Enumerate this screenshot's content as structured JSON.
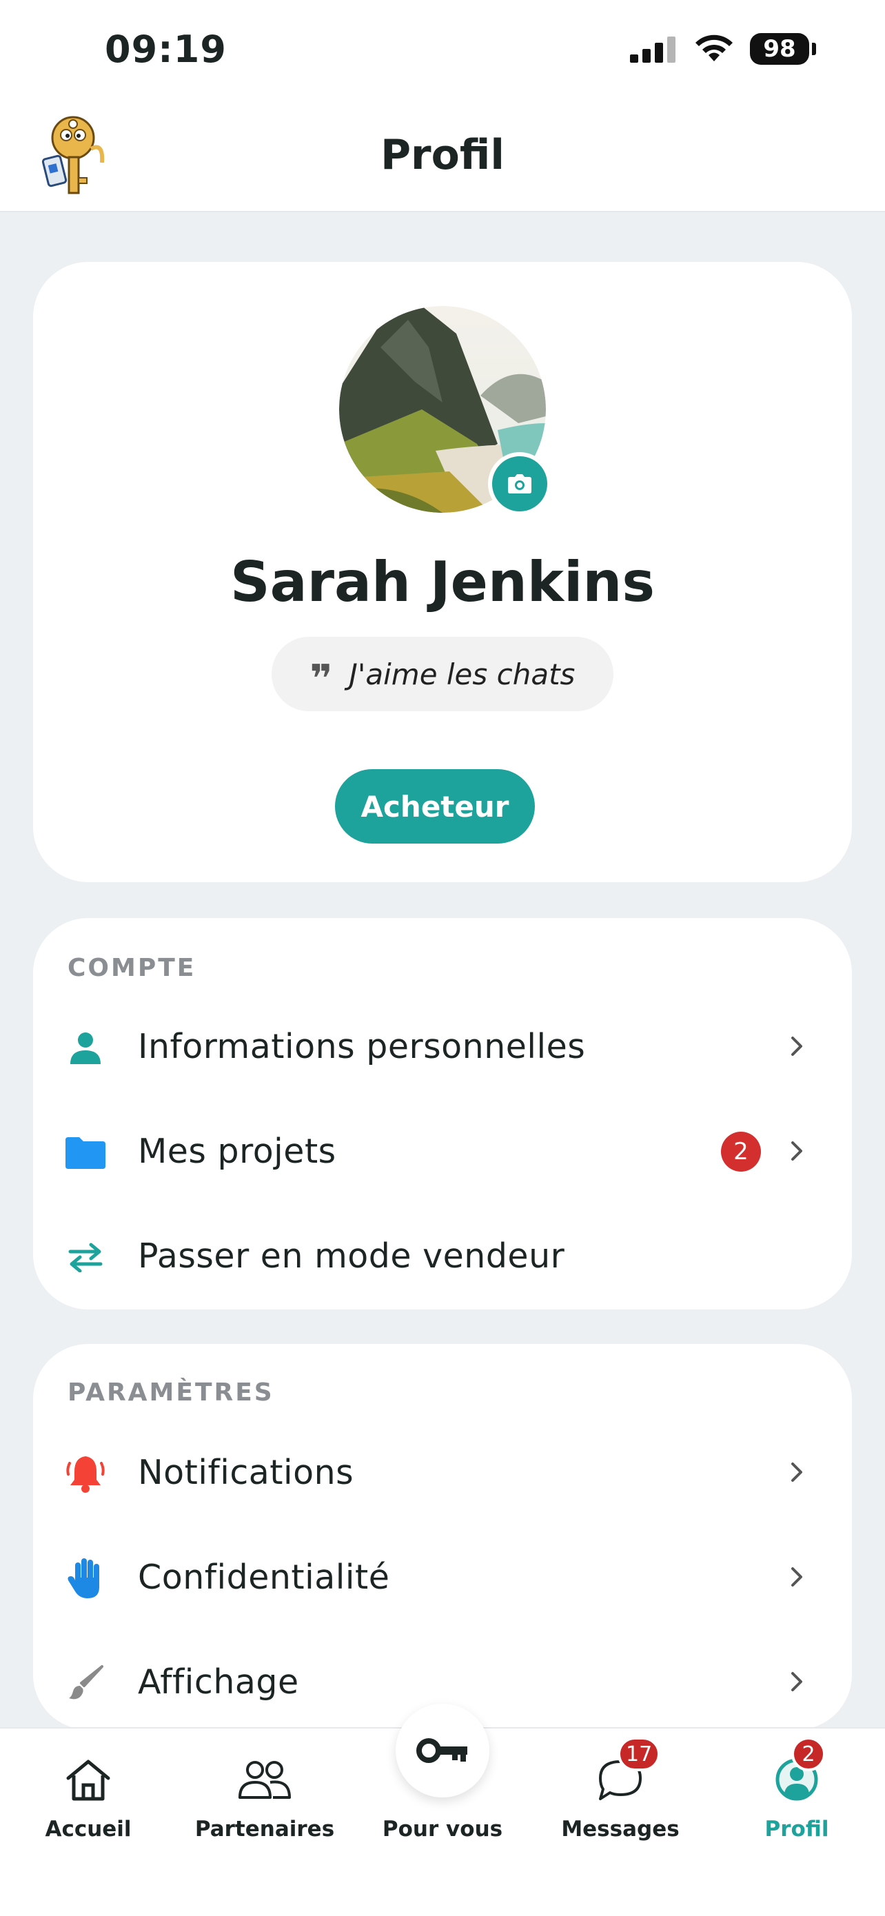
{
  "status_bar": {
    "time": "09:19",
    "battery": "98"
  },
  "header": {
    "title": "Profil"
  },
  "profile": {
    "name": "Sarah Jenkins",
    "quote": "J'aime les chats",
    "role": "Acheteur"
  },
  "account": {
    "title": "COMPTE",
    "items": [
      {
        "label": "Informations personnelles",
        "icon": "person-icon"
      },
      {
        "label": "Mes projets",
        "icon": "folder-icon",
        "badge": "2"
      },
      {
        "label": "Passer en mode vendeur",
        "icon": "swap-icon"
      }
    ]
  },
  "settings": {
    "title": "PARAMÈTRES",
    "items": [
      {
        "label": "Notifications",
        "icon": "bell-icon"
      },
      {
        "label": "Confidentialité",
        "icon": "hand-icon"
      },
      {
        "label": "Affichage",
        "icon": "brush-icon"
      }
    ]
  },
  "nav": {
    "items": [
      {
        "label": "Accueil",
        "icon": "home-icon"
      },
      {
        "label": "Partenaires",
        "icon": "people-icon"
      },
      {
        "label": "Pour vous",
        "icon": "key-icon"
      },
      {
        "label": "Messages",
        "icon": "chat-icon",
        "badge": "17"
      },
      {
        "label": "Profil",
        "icon": "profile-icon",
        "badge": "2",
        "active": true
      }
    ]
  },
  "colors": {
    "accent": "#1ea29c",
    "badge": "#d32f2f",
    "folder": "#2196f3",
    "bell": "#f44336",
    "hand": "#1e88e5"
  }
}
